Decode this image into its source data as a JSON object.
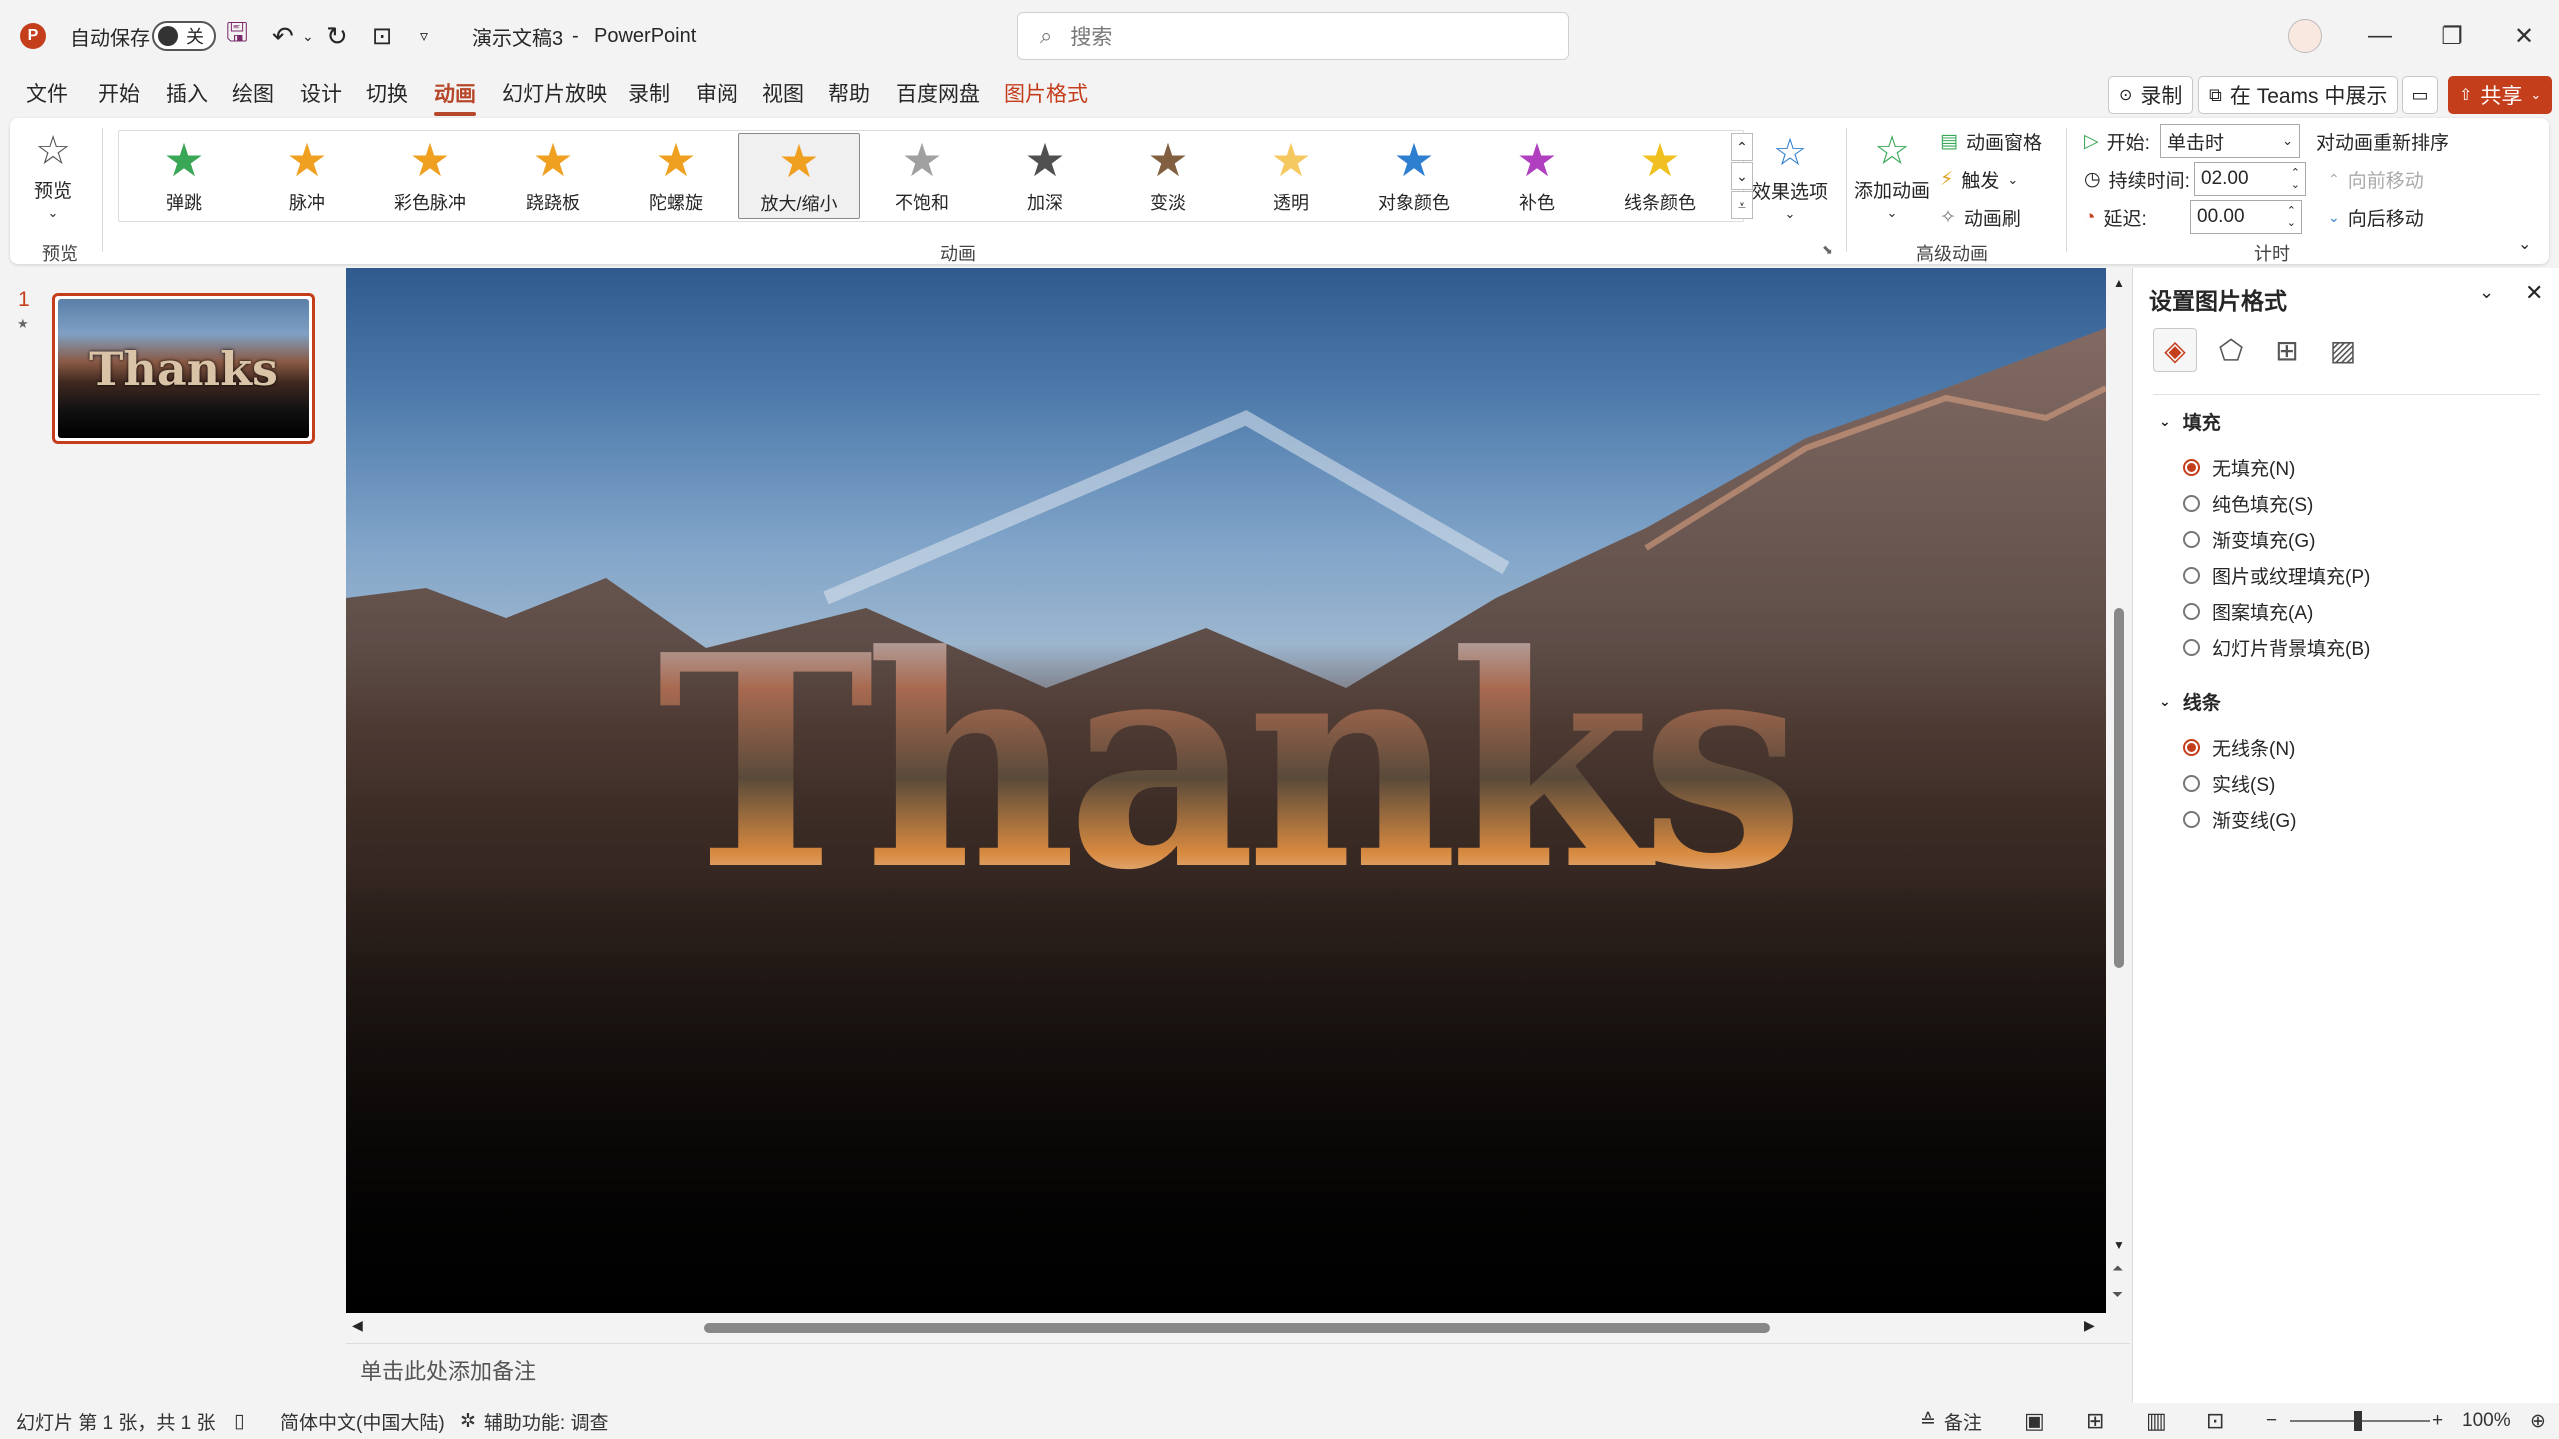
{
  "titlebar": {
    "autosave_label": "自动保存",
    "autosave_state": "关",
    "doc_title": "演示文稿3",
    "separator": "-",
    "app_name": "PowerPoint",
    "search_placeholder": "搜索"
  },
  "menu": {
    "items": [
      "文件",
      "开始",
      "插入",
      "绘图",
      "设计",
      "切换",
      "动画",
      "幻灯片放映",
      "录制",
      "审阅",
      "视图",
      "帮助",
      "百度网盘",
      "图片格式"
    ],
    "active": "动画",
    "record_label": "录制",
    "teams_label": "在 Teams 中展示",
    "share_label": "共享"
  },
  "ribbon": {
    "preview": {
      "label": "预览",
      "group": "预览"
    },
    "animations": [
      {
        "label": "弹跳",
        "color": "#3aa757"
      },
      {
        "label": "脉冲",
        "color": "#f0a020"
      },
      {
        "label": "彩色脉冲",
        "color": "#f0a020"
      },
      {
        "label": "跷跷板",
        "color": "#f0a020"
      },
      {
        "label": "陀螺旋",
        "color": "#f0a020"
      },
      {
        "label": "放大/缩小",
        "color": "#f0a020"
      },
      {
        "label": "不饱和",
        "color": "#a0a0a0"
      },
      {
        "label": "加深",
        "color": "#505050"
      },
      {
        "label": "变淡",
        "color": "#806040"
      },
      {
        "label": "透明",
        "color": "#f5c860"
      },
      {
        "label": "对象颜色",
        "color": "#2f7fd0"
      },
      {
        "label": "补色",
        "color": "#b040c0"
      },
      {
        "label": "线条颜色",
        "color": "#f0c020"
      }
    ],
    "selected_animation": "放大/缩小",
    "effect_options": "效果选项",
    "group_animation": "动画",
    "add_animation": "添加动画",
    "animation_pane": "动画窗格",
    "trigger": "触发",
    "animation_painter": "动画刷",
    "group_advanced": "高级动画",
    "start_label": "开始:",
    "start_value": "单击时",
    "duration_label": "持续时间:",
    "duration_value": "02.00",
    "delay_label": "延迟:",
    "delay_value": "00.00",
    "reorder_label": "对动画重新排序",
    "move_earlier": "向前移动",
    "move_later": "向后移动",
    "group_timing": "计时"
  },
  "slides_panel": {
    "number": "1",
    "star": "★",
    "thumb_text": "Thanks"
  },
  "slide": {
    "text": "Thanks"
  },
  "notes": {
    "placeholder": "单击此处添加备注"
  },
  "format_pane": {
    "title": "设置图片格式",
    "fill_section": "填充",
    "fill_options": [
      "无填充(N)",
      "纯色填充(S)",
      "渐变填充(G)",
      "图片或纹理填充(P)",
      "图案填充(A)",
      "幻灯片背景填充(B)"
    ],
    "fill_selected": 0,
    "line_section": "线条",
    "line_options": [
      "无线条(N)",
      "实线(S)",
      "渐变线(G)"
    ],
    "line_selected": 0
  },
  "status": {
    "slide_info": "幻灯片 第 1 张，共 1 张",
    "language": "简体中文(中国大陆)",
    "accessibility": "辅助功能: 调查",
    "notes_label": "备注",
    "zoom": "100%"
  }
}
